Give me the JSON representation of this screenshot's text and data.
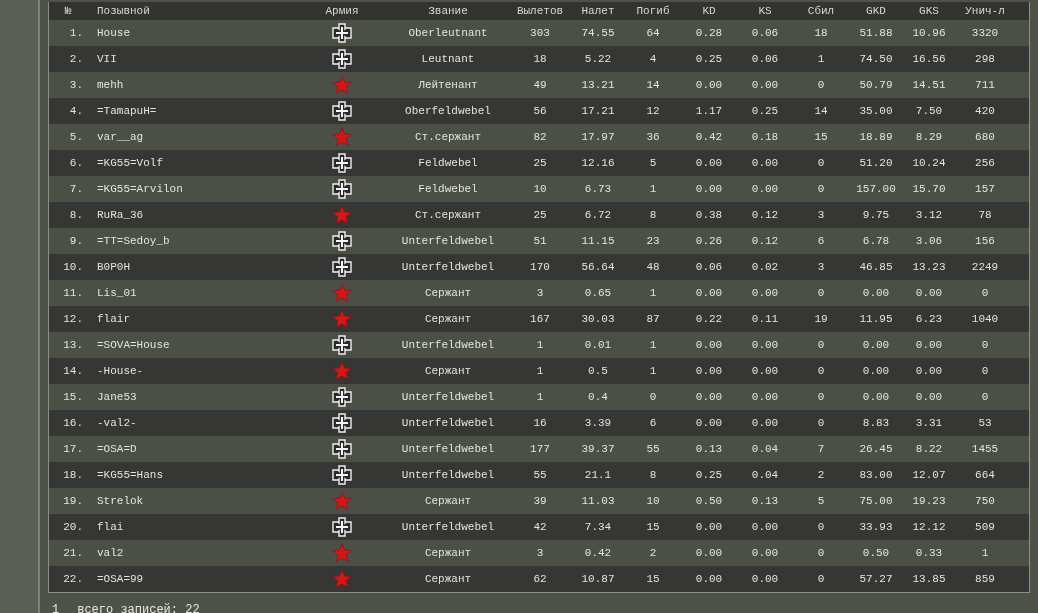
{
  "table": {
    "columns": [
      "№",
      "Позывной",
      "Армия",
      "Звание",
      "Вылетов",
      "Налет",
      "Погиб",
      "KD",
      "KS",
      "Сбил",
      "GKD",
      "GKS",
      "Унич-л"
    ],
    "rows": [
      {
        "num": "1.",
        "callsign": "House",
        "kind": "german",
        "rank": "Oberleutnant",
        "stats": [
          "303",
          "74.55",
          "64",
          "0.28",
          "0.06",
          "18",
          "51.88",
          "10.96",
          "3320"
        ]
      },
      {
        "num": "2.",
        "callsign": "VII",
        "kind": "german",
        "rank": "Leutnant",
        "stats": [
          "18",
          "5.22",
          "4",
          "0.25",
          "0.06",
          "1",
          "74.50",
          "16.56",
          "298"
        ]
      },
      {
        "num": "3.",
        "callsign": "mehh",
        "kind": "soviet",
        "rank": "Лейтенант",
        "stats": [
          "49",
          "13.21",
          "14",
          "0.00",
          "0.00",
          "0",
          "50.79",
          "14.51",
          "711"
        ]
      },
      {
        "num": "4.",
        "callsign": "=TamapuH=",
        "kind": "german",
        "rank": "Oberfeldwebel",
        "stats": [
          "56",
          "17.21",
          "12",
          "1.17",
          "0.25",
          "14",
          "35.00",
          "7.50",
          "420"
        ]
      },
      {
        "num": "5.",
        "callsign": "var__ag",
        "kind": "soviet",
        "rank": "Ст.сержант",
        "stats": [
          "82",
          "17.97",
          "36",
          "0.42",
          "0.18",
          "15",
          "18.89",
          "8.29",
          "680"
        ]
      },
      {
        "num": "6.",
        "callsign": "=KG55=Volf",
        "kind": "german",
        "rank": "Feldwebel",
        "stats": [
          "25",
          "12.16",
          "5",
          "0.00",
          "0.00",
          "0",
          "51.20",
          "10.24",
          "256"
        ]
      },
      {
        "num": "7.",
        "callsign": "=KG55=Arvilon",
        "kind": "german",
        "rank": "Feldwebel",
        "stats": [
          "10",
          "6.73",
          "1",
          "0.00",
          "0.00",
          "0",
          "157.00",
          "15.70",
          "157"
        ]
      },
      {
        "num": "8.",
        "callsign": "RuRa_36",
        "kind": "soviet",
        "rank": "Ст.сержант",
        "stats": [
          "25",
          "6.72",
          "8",
          "0.38",
          "0.12",
          "3",
          "9.75",
          "3.12",
          "78"
        ]
      },
      {
        "num": "9.",
        "callsign": "=TT=Sedoy_b",
        "kind": "german",
        "rank": "Unterfeldwebel",
        "stats": [
          "51",
          "11.15",
          "23",
          "0.26",
          "0.12",
          "6",
          "6.78",
          "3.06",
          "156"
        ]
      },
      {
        "num": "10.",
        "callsign": "B0P0H",
        "kind": "german",
        "rank": "Unterfeldwebel",
        "stats": [
          "170",
          "56.64",
          "48",
          "0.06",
          "0.02",
          "3",
          "46.85",
          "13.23",
          "2249"
        ]
      },
      {
        "num": "11.",
        "callsign": "Lis_01",
        "kind": "soviet",
        "rank": "Сержант",
        "stats": [
          "3",
          "0.65",
          "1",
          "0.00",
          "0.00",
          "0",
          "0.00",
          "0.00",
          "0"
        ]
      },
      {
        "num": "12.",
        "callsign": "flair",
        "kind": "soviet",
        "rank": "Сержант",
        "stats": [
          "167",
          "30.03",
          "87",
          "0.22",
          "0.11",
          "19",
          "11.95",
          "6.23",
          "1040"
        ]
      },
      {
        "num": "13.",
        "callsign": "=SOVA=House",
        "kind": "german",
        "rank": "Unterfeldwebel",
        "stats": [
          "1",
          "0.01",
          "1",
          "0.00",
          "0.00",
          "0",
          "0.00",
          "0.00",
          "0"
        ]
      },
      {
        "num": "14.",
        "callsign": "-House-",
        "kind": "soviet",
        "rank": "Сержант",
        "stats": [
          "1",
          "0.5",
          "1",
          "0.00",
          "0.00",
          "0",
          "0.00",
          "0.00",
          "0"
        ]
      },
      {
        "num": "15.",
        "callsign": "Jane53",
        "kind": "german",
        "rank": "Unterfeldwebel",
        "stats": [
          "1",
          "0.4",
          "0",
          "0.00",
          "0.00",
          "0",
          "0.00",
          "0.00",
          "0"
        ]
      },
      {
        "num": "16.",
        "callsign": "-val2-",
        "kind": "german",
        "rank": "Unterfeldwebel",
        "stats": [
          "16",
          "3.39",
          "6",
          "0.00",
          "0.00",
          "0",
          "8.83",
          "3.31",
          "53"
        ]
      },
      {
        "num": "17.",
        "callsign": "=OSA=D",
        "kind": "german",
        "rank": "Unterfeldwebel",
        "stats": [
          "177",
          "39.37",
          "55",
          "0.13",
          "0.04",
          "7",
          "26.45",
          "8.22",
          "1455"
        ]
      },
      {
        "num": "18.",
        "callsign": "=KG55=Hans",
        "kind": "german",
        "rank": "Unterfeldwebel",
        "stats": [
          "55",
          "21.1",
          "8",
          "0.25",
          "0.04",
          "2",
          "83.00",
          "12.07",
          "664"
        ]
      },
      {
        "num": "19.",
        "callsign": "Strelok",
        "kind": "soviet",
        "rank": "Сержант",
        "stats": [
          "39",
          "11.03",
          "10",
          "0.50",
          "0.13",
          "5",
          "75.00",
          "19.23",
          "750"
        ]
      },
      {
        "num": "20.",
        "callsign": "flai",
        "kind": "german",
        "rank": "Unterfeldwebel",
        "stats": [
          "42",
          "7.34",
          "15",
          "0.00",
          "0.00",
          "0",
          "33.93",
          "12.12",
          "509"
        ]
      },
      {
        "num": "21.",
        "callsign": "val2",
        "kind": "soviet",
        "rank": "Сержант",
        "stats": [
          "3",
          "0.42",
          "2",
          "0.00",
          "0.00",
          "0",
          "0.50",
          "0.33",
          "1"
        ]
      },
      {
        "num": "22.",
        "callsign": "=OSA=99",
        "kind": "soviet",
        "rank": "Сержант",
        "stats": [
          "62",
          "10.87",
          "15",
          "0.00",
          "0.00",
          "0",
          "57.27",
          "13.85",
          "859"
        ]
      }
    ]
  },
  "footer": {
    "page": "1",
    "total": "всего записей: 22"
  }
}
